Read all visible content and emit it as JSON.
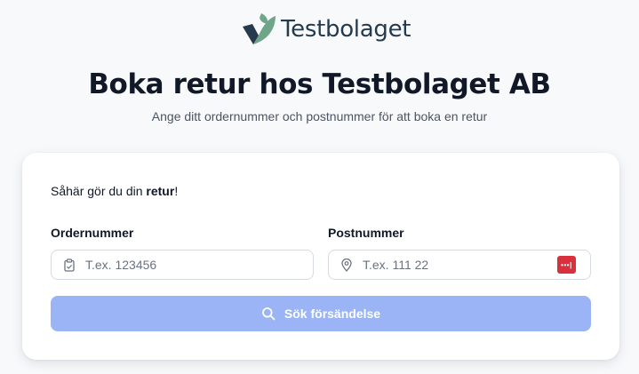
{
  "brand": {
    "name": "Testbolaget",
    "colors": {
      "leaf_dark": "#253b4d",
      "leaf_green": "#6fa68a"
    }
  },
  "header": {
    "title": "Boka retur hos Testbolaget AB",
    "subtitle": "Ange ditt ordernummer och postnummer för att boka en retur"
  },
  "form": {
    "instruction_prefix": "Såhär gör du din ",
    "instruction_bold": "retur",
    "instruction_suffix": "!",
    "order": {
      "label": "Ordernummer",
      "placeholder": "T.ex. 123456",
      "value": "",
      "icon": "clipboard-icon"
    },
    "postal": {
      "label": "Postnummer",
      "placeholder": "T.ex. 111 22",
      "value": "",
      "icon": "map-pin-icon",
      "extension_icon": "password-manager-icon"
    },
    "submit": {
      "label": "Sök försändelse",
      "icon": "search-icon",
      "color": "#9bb4f5",
      "state": "disabled"
    }
  }
}
